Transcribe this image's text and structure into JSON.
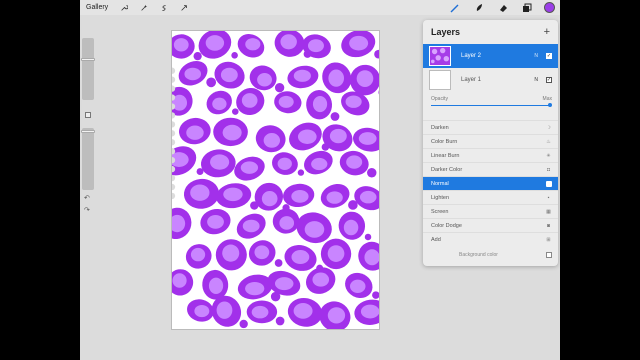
{
  "toolbar": {
    "gallery_label": "Gallery",
    "left_icons": [
      "wrench-icon",
      "magic-wand-icon",
      "selection-icon",
      "transform-arrow-icon"
    ],
    "right_icons": [
      "brush-icon",
      "smudge-icon",
      "eraser-icon",
      "layers-icon"
    ],
    "current_color": "#9b3ee8"
  },
  "sidebar": {
    "undo_glyph": "↶",
    "redo_glyph": "↷"
  },
  "canvas": {
    "background": "#ffffff",
    "pattern_light": "#c985ff",
    "pattern_dark": "#a230ea"
  },
  "layers_panel": {
    "title": "Layers",
    "add_glyph": "+",
    "layers": [
      {
        "name": "Layer 2",
        "mode": "N",
        "selected": true
      },
      {
        "name": "Layer 1",
        "mode": "N",
        "selected": false
      }
    ],
    "opacity_label": "Opacity",
    "opacity_value": "Max",
    "blend_modes": [
      {
        "name": "Darken",
        "icon": "moon-icon",
        "glyph": "☽",
        "selected": false
      },
      {
        "name": "Color Burn",
        "icon": "flame-icon",
        "glyph": "♨",
        "selected": false
      },
      {
        "name": "Linear Burn",
        "icon": "burst-icon",
        "glyph": "✳",
        "selected": false
      },
      {
        "name": "Darker Color",
        "icon": "darker-square-icon",
        "glyph": "◘",
        "selected": false
      },
      {
        "name": "Normal",
        "icon": "normal-square-icon",
        "glyph": "",
        "selected": true
      },
      {
        "name": "Lighten",
        "icon": "lighten-square-icon",
        "glyph": "▪",
        "selected": false
      },
      {
        "name": "Screen",
        "icon": "screen-icon",
        "glyph": "▦",
        "selected": false
      },
      {
        "name": "Color Dodge",
        "icon": "dodge-icon",
        "glyph": "◙",
        "selected": false
      },
      {
        "name": "Add",
        "icon": "add-icon",
        "glyph": "⊞",
        "selected": false
      }
    ],
    "background_label": "Background color"
  }
}
